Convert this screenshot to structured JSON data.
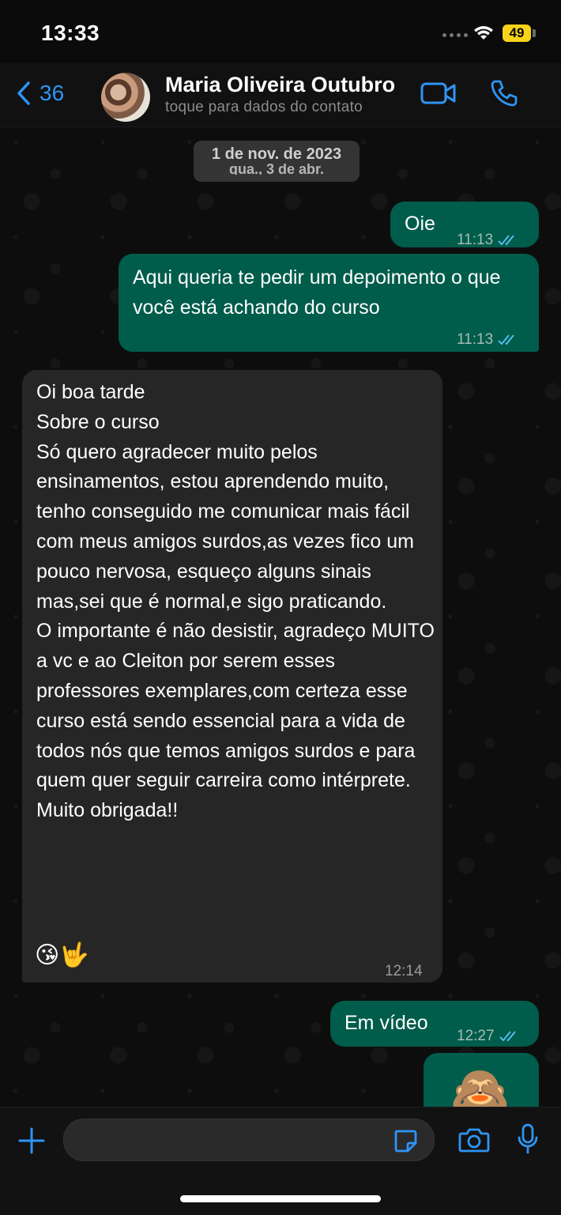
{
  "status_bar": {
    "time": "13:33",
    "battery": "49"
  },
  "header": {
    "back_count": "36",
    "contact_name": "Maria Oliveira Outubro",
    "contact_subtitle": "toque para dados do contato",
    "accent_color": "#2e95f5"
  },
  "date_pill": {
    "primary": "1 de nov. de 2023",
    "secondary": "qua., 3 de abr."
  },
  "messages": [
    {
      "direction": "outgoing",
      "text": "Oie",
      "time": "11:13",
      "status": "read"
    },
    {
      "direction": "outgoing",
      "text": "Aqui queria te pedir um depoimento o que você está achando do curso",
      "time": "11:13",
      "status": "read"
    },
    {
      "direction": "incoming",
      "text": "Oi boa tarde\nSobre o curso\nSó quero agradecer muito pelos ensinamentos, estou aprendendo muito, tenho conseguido me comunicar mais fácil com meus amigos surdos,as vezes fico um pouco nervosa, esqueço alguns sinais mas,sei que é normal,e sigo praticando.\nO importante é não desistir, agradeço MUITO a vc e ao Cleiton por serem esses professores exemplares,com certeza esse curso está sendo essencial para a vida de todos nós que temos amigos surdos e para quem quer seguir carreira como intérprete.\nMuito obrigada!!",
      "emoji": "😘🤟",
      "time": "12:14"
    },
    {
      "direction": "outgoing",
      "text": "Em vídeo",
      "time": "12:27",
      "status": "read"
    },
    {
      "direction": "outgoing",
      "emoji": "🙈"
    }
  ],
  "colors": {
    "outgoing_bubble": "#005c4b",
    "incoming_bubble": "#262626",
    "read_ticks": "#53bdeb"
  }
}
